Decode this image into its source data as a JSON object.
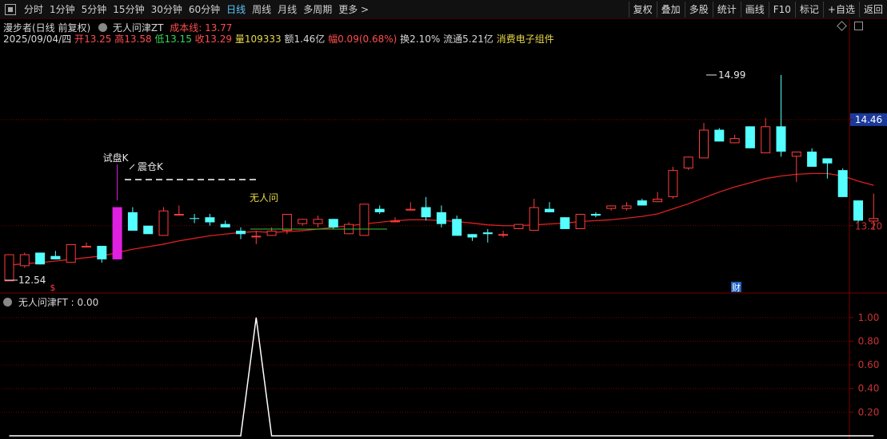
{
  "toolbar": {
    "periods": [
      "分时",
      "1分钟",
      "5分钟",
      "15分钟",
      "30分钟",
      "60分钟",
      "日线",
      "周线",
      "月线",
      "多周期",
      "更多 >"
    ],
    "active_period": "日线",
    "right_buttons": [
      "复权",
      "叠加",
      "多股",
      "统计",
      "画线",
      "F10",
      "标记",
      "+自选",
      "返回"
    ]
  },
  "header": {
    "stock_name": "漫步者(日线 前复权)",
    "indicator_name": "无人问津ZT",
    "cost_line_label": "成本线: 13.77",
    "date": "2025/09/04/四",
    "open_label": "开",
    "open": "13.25",
    "high_label": "高",
    "high": "13.58",
    "low_label": "低",
    "low": "13.15",
    "close_label": "收",
    "close": "13.29",
    "volume_label": "量",
    "volume": "109333",
    "amount_label": "额",
    "amount": "1.46亿",
    "change_label": "幅",
    "change": "0.09(0.68%)",
    "turnover_label": "换",
    "turnover": "2.10%",
    "float_label": "流通",
    "float_value": "5.21亿",
    "concept": "消费电子组件"
  },
  "sub_header": {
    "label": "无人问津FT : 0.00"
  },
  "annotations": {
    "test_k": "试盘K",
    "shake_k": "震仓K",
    "nobody": "无人问",
    "max_price": "14.99",
    "min_price": "12.54",
    "price_tag_upper": "14.46",
    "price_tag_lower": "13.20",
    "cai_marker": "财",
    "s_marker": "$"
  },
  "colors": {
    "up": "#ff3c3c",
    "down": "#54ffff",
    "signal": "#e020e0",
    "ma": "#e02020",
    "grid": "#7a0000",
    "axis_text": "#c83232",
    "dash": "#ffffff",
    "support": "#36c43a",
    "osc": "#ffffff"
  },
  "chart_data": [
    {
      "type": "candlestick",
      "title": "漫步者(日线 前复权)",
      "ylim": [
        12.42,
        15.35
      ],
      "y_ticks": [
        14.46,
        13.2
      ],
      "series": [
        {
          "name": "K线",
          "ohlc": [
            [
              12.54,
              12.86,
              12.54,
              12.86
            ],
            [
              12.72,
              12.88,
              12.7,
              12.86
            ],
            [
              12.88,
              12.88,
              12.74,
              12.74
            ],
            [
              12.84,
              12.9,
              12.8,
              12.8
            ],
            [
              12.76,
              12.98,
              12.76,
              12.98
            ],
            [
              12.96,
              13.0,
              12.94,
              12.96
            ],
            [
              12.96,
              12.96,
              12.76,
              12.8
            ],
            [
              12.8,
              13.42,
              12.8,
              13.42
            ],
            [
              13.36,
              13.42,
              13.14,
              13.14
            ],
            [
              13.2,
              13.2,
              13.1,
              13.1
            ],
            [
              13.08,
              13.42,
              13.08,
              13.38
            ],
            [
              13.34,
              13.44,
              13.32,
              13.34
            ],
            [
              13.29,
              13.34,
              13.23,
              13.28
            ],
            [
              13.3,
              13.34,
              13.2,
              13.24
            ],
            [
              13.22,
              13.26,
              13.18,
              13.18
            ],
            [
              13.14,
              13.18,
              13.04,
              13.1
            ],
            [
              13.08,
              13.14,
              12.98,
              13.08
            ],
            [
              13.08,
              13.18,
              13.08,
              13.14
            ],
            [
              13.14,
              13.34,
              13.1,
              13.34
            ],
            [
              13.22,
              13.28,
              13.2,
              13.28
            ],
            [
              13.22,
              13.32,
              13.18,
              13.28
            ],
            [
              13.28,
              13.28,
              13.16,
              13.18
            ],
            [
              13.1,
              13.24,
              13.1,
              13.22
            ],
            [
              13.08,
              13.46,
              13.08,
              13.46
            ],
            [
              13.4,
              13.44,
              13.34,
              13.36
            ],
            [
              13.26,
              13.3,
              13.24,
              13.26
            ],
            [
              13.38,
              13.48,
              13.38,
              13.4
            ],
            [
              13.42,
              13.54,
              13.26,
              13.3
            ],
            [
              13.36,
              13.44,
              13.18,
              13.22
            ],
            [
              13.28,
              13.32,
              13.08,
              13.08
            ],
            [
              13.1,
              13.1,
              13.02,
              13.06
            ],
            [
              13.12,
              13.16,
              13.0,
              13.1
            ],
            [
              13.1,
              13.14,
              13.06,
              13.1
            ],
            [
              13.16,
              13.22,
              13.16,
              13.22
            ],
            [
              13.14,
              13.52,
              13.14,
              13.42
            ],
            [
              13.4,
              13.48,
              13.36,
              13.36
            ],
            [
              13.3,
              13.3,
              13.16,
              13.16
            ],
            [
              13.16,
              13.34,
              13.16,
              13.34
            ],
            [
              13.34,
              13.36,
              13.3,
              13.32
            ],
            [
              13.4,
              13.44,
              13.38,
              13.44
            ],
            [
              13.4,
              13.48,
              13.38,
              13.44
            ],
            [
              13.5,
              13.52,
              13.44,
              13.44
            ],
            [
              13.48,
              13.6,
              13.48,
              13.52
            ],
            [
              13.54,
              13.9,
              13.52,
              13.86
            ],
            [
              13.88,
              14.02,
              13.86,
              14.02
            ],
            [
              14.0,
              14.42,
              14.0,
              14.34
            ],
            [
              14.34,
              14.36,
              14.2,
              14.2
            ],
            [
              14.18,
              14.28,
              14.18,
              14.24
            ],
            [
              14.38,
              14.38,
              14.12,
              14.12
            ],
            [
              14.06,
              14.48,
              14.06,
              14.38
            ],
            [
              14.38,
              14.99,
              14.02,
              14.08
            ],
            [
              14.02,
              14.08,
              13.72,
              14.08
            ],
            [
              14.08,
              14.12,
              13.9,
              13.9
            ],
            [
              14.0,
              14.0,
              13.76,
              13.94
            ],
            [
              13.86,
              13.88,
              13.8,
              13.54
            ],
            [
              13.5,
              13.5,
              13.18,
              13.26
            ],
            [
              13.25,
              13.58,
              13.15,
              13.29
            ]
          ]
        },
        {
          "name": "成本线",
          "values": [
            12.73,
            12.75,
            12.76,
            12.78,
            12.8,
            12.82,
            12.84,
            12.88,
            12.92,
            12.95,
            12.98,
            13.02,
            13.05,
            13.08,
            13.1,
            13.12,
            13.13,
            13.12,
            13.13,
            13.14,
            13.16,
            13.18,
            13.2,
            13.22,
            13.24,
            13.26,
            13.27,
            13.27,
            13.26,
            13.25,
            13.23,
            13.21,
            13.2,
            13.2,
            13.21,
            13.22,
            13.23,
            13.25,
            13.26,
            13.27,
            13.29,
            13.31,
            13.34,
            13.4,
            13.46,
            13.53,
            13.6,
            13.66,
            13.71,
            13.76,
            13.79,
            13.81,
            13.82,
            13.82,
            13.79,
            13.73,
            13.68
          ]
        }
      ]
    },
    {
      "type": "line",
      "title": "无人问津FT",
      "ylim": [
        0,
        1.1
      ],
      "y_ticks": [
        "1.00",
        "0.80",
        "0.60",
        "0.40",
        "0.20"
      ],
      "series": [
        {
          "name": "无人问津FT",
          "values": [
            0,
            0,
            0,
            0,
            0,
            0,
            0,
            0,
            0,
            0,
            0,
            0,
            0,
            0,
            0,
            0,
            1,
            0,
            0,
            0,
            0,
            0,
            0,
            0,
            0,
            0,
            0,
            0,
            0,
            0,
            0,
            0,
            0,
            0,
            0,
            0,
            0,
            0,
            0,
            0,
            0,
            0,
            0,
            0,
            0,
            0,
            0,
            0,
            0,
            0,
            0,
            0,
            0,
            0,
            0,
            0,
            0
          ]
        }
      ]
    }
  ]
}
